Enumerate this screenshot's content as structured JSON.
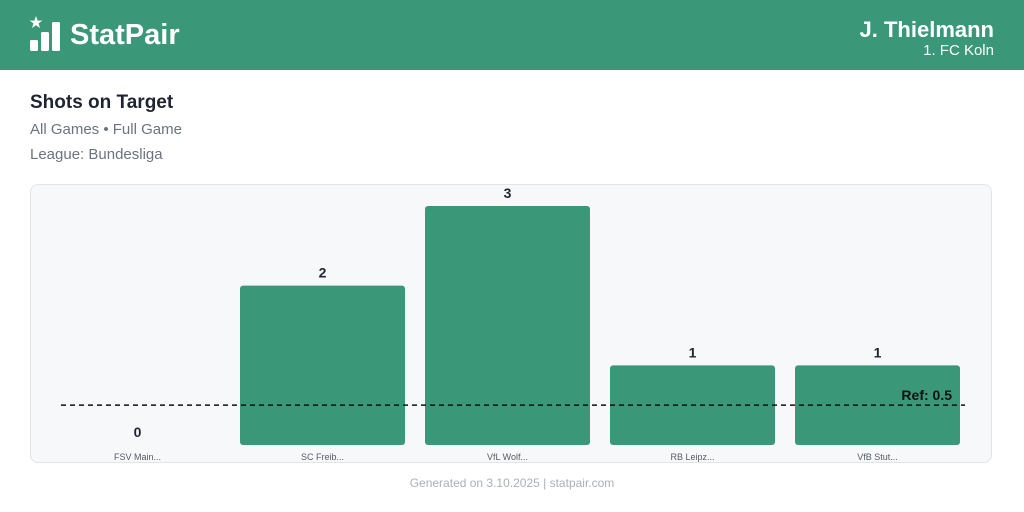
{
  "brand": {
    "name": "StatPair",
    "color": "#3a9878"
  },
  "player": {
    "name": "J. Thielmann",
    "team": "1. FC Koln"
  },
  "title": "Shots on Target",
  "subtitle": "All Games • Full Game",
  "league": "League: Bundesliga",
  "footer": "Generated on 3.10.2025 | statpair.com",
  "chart_data": {
    "type": "bar",
    "categories": [
      "FSV Main...",
      "SC Freib...",
      "VfL Wolf...",
      "RB Leipz...",
      "VfB Stut..."
    ],
    "values": [
      0,
      2,
      3,
      1,
      1
    ],
    "ylim": [
      0,
      3
    ],
    "reference_line": {
      "value": 0.5,
      "label": "Ref: 0.5"
    },
    "bar_color": "#3a9878",
    "grid": false
  }
}
